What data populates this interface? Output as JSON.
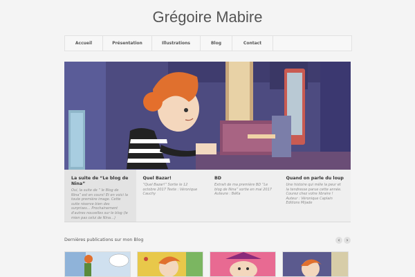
{
  "site": {
    "title": "Grégoire Mabire"
  },
  "nav": {
    "items": [
      {
        "label": "Accueil"
      },
      {
        "label": "Présentation"
      },
      {
        "label": "Illustrations"
      },
      {
        "label": "Blog"
      },
      {
        "label": "Contact"
      }
    ]
  },
  "slider": {
    "captions": [
      {
        "title": "La suite de “Le blog de Nina”",
        "text": "Oui, la suite de “ le Blog de Nina” est en cours! Et en voici la toute première image. Cette suite réserve bien des surprises… Prochainement d'autres nouvelles sur le blog (le mien pas celui de Nina…)"
      },
      {
        "title": "Quel Bazar!",
        "text": "“Quel Bazar!” Sortie le 12 octobre 2017 Texte : Véronique Cauchy"
      },
      {
        "title": "BD",
        "text": "Extrait de ma première BD “Le blog de Nina” sortie en mai 2017 Auteure : BéKa"
      },
      {
        "title": "Quand on parle du loup",
        "text": "Une histoire qui mêle la peur et la tendresse parue cette année. Courez chez votre libraire ! Auteur : Véronique Caplain Editions Mijade"
      }
    ]
  },
  "blog": {
    "heading": "Dernières publications sur mon Blog",
    "prev": "‹",
    "next": "›"
  },
  "colors": {
    "background": "#f4f4f4",
    "hero_bg": "#4f4e85",
    "hair": "#e0702e"
  }
}
